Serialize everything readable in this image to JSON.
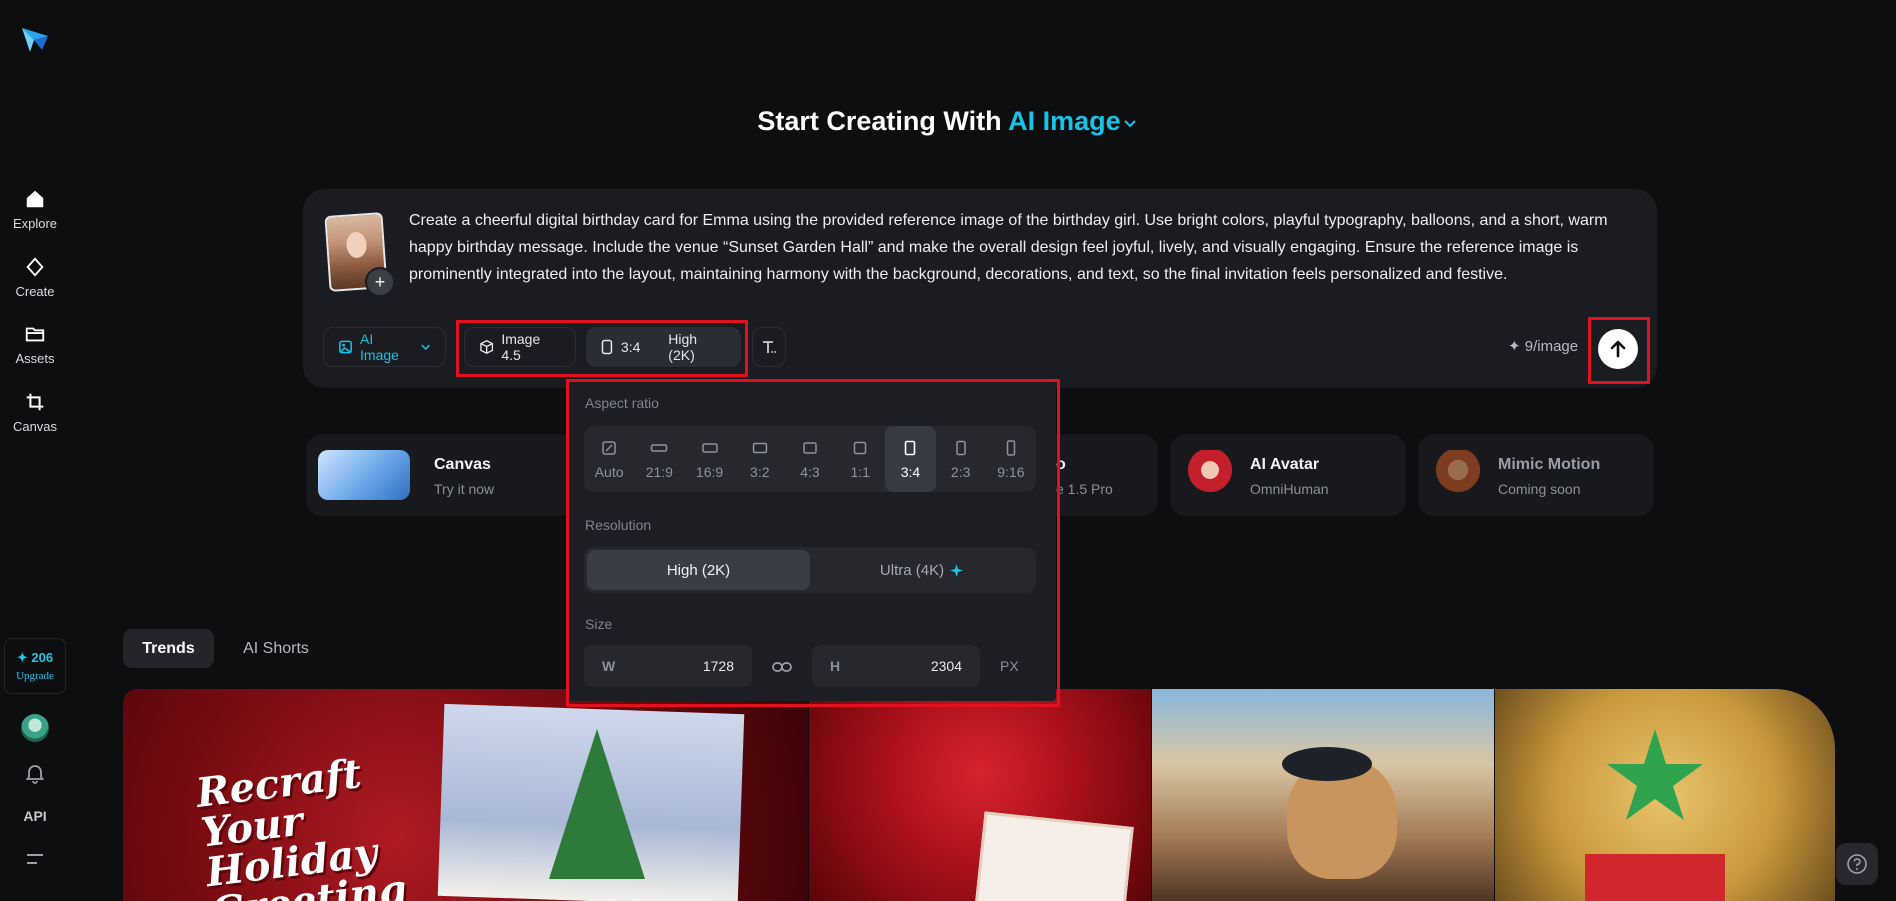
{
  "sidebar": {
    "items": [
      {
        "label": "Explore",
        "icon": "home-icon"
      },
      {
        "label": "Create",
        "icon": "diamond-icon"
      },
      {
        "label": "Assets",
        "icon": "folder-icon"
      },
      {
        "label": "Canvas",
        "icon": "crop-icon"
      }
    ],
    "credits": "✦ 206",
    "upgrade": "Upgrade",
    "api": "API"
  },
  "heading": {
    "prefix": "Start Creating With",
    "mode": "AI Image"
  },
  "prompt": {
    "text": "Create a cheerful digital birthday card for Emma using the provided reference image of the birthday girl. Use bright colors, playful typography, balloons, and a short, warm happy birthday message. Include the venue “Sunset Garden Hall” and make the overall design feel joyful, lively, and visually engaging. Ensure the reference image is prominently integrated into the layout, maintaining harmony with the background, decorations, and text, so the final invitation feels personalized and festive."
  },
  "toolbar": {
    "mode_label": "AI Image",
    "model_label": "Image 4.5",
    "ratio_label": "3:4",
    "resolution_label": "High (2K)",
    "cost": "✦ 9/image"
  },
  "panel": {
    "aspect_title": "Aspect ratio",
    "ratios": [
      {
        "label": "Auto"
      },
      {
        "label": "21:9"
      },
      {
        "label": "16:9"
      },
      {
        "label": "3:2"
      },
      {
        "label": "4:3"
      },
      {
        "label": "1:1"
      },
      {
        "label": "3:4"
      },
      {
        "label": "2:3"
      },
      {
        "label": "9:16"
      }
    ],
    "selected_ratio": "3:4",
    "resolution_title": "Resolution",
    "resolutions": [
      {
        "label": "High (2K)"
      },
      {
        "label": "Ultra (4K)"
      }
    ],
    "selected_resolution": "High (2K)",
    "size_title": "Size",
    "width_label": "W",
    "width_value": "1728",
    "height_label": "H",
    "height_value": "2304",
    "unit": "PX"
  },
  "features": [
    {
      "title": "Canvas",
      "subtitle": "Try it now"
    },
    {
      "title": "o",
      "subtitle": "e 1.5 Pro"
    },
    {
      "title": "AI Avatar",
      "subtitle": "OmniHuman"
    },
    {
      "title": "Mimic Motion",
      "subtitle": "Coming soon"
    }
  ],
  "tabs": [
    {
      "label": "Trends"
    },
    {
      "label": "AI Shorts"
    }
  ],
  "gallery": {
    "tile1_text": "Recraft Your Holiday Greeting"
  },
  "colors": {
    "accent": "#18c3e6",
    "highlight": "#e3101f",
    "background": "#0d0e10"
  }
}
